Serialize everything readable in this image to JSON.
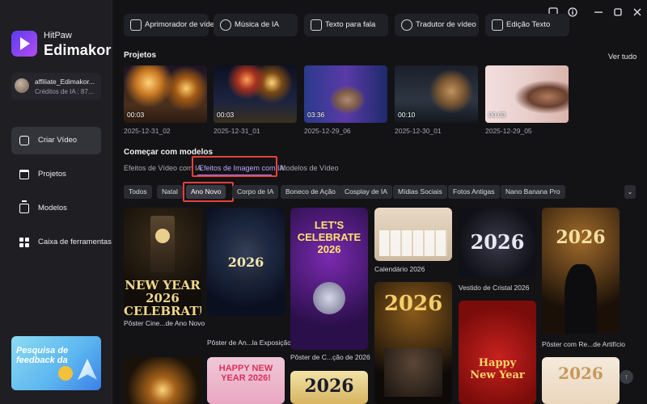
{
  "app": {
    "brand_top": "HitPaw",
    "brand_bottom": "Edimakor"
  },
  "account": {
    "name": "affiliate_Edimakor...",
    "credits": "Créditos de IA : 87..."
  },
  "nav": [
    {
      "label": "Criar Vídeo",
      "icon": "video-icon"
    },
    {
      "label": "Projetos",
      "icon": "folder-icon"
    },
    {
      "label": "Modelos",
      "icon": "templates-icon"
    },
    {
      "label": "Caixa de ferramentas",
      "icon": "toolbox-icon"
    }
  ],
  "promo": {
    "text": "Pesquisa de feedback da"
  },
  "tools": [
    {
      "label": "Aprimorador de vídeo",
      "icon": "video-enhance-icon"
    },
    {
      "label": "Música de IA",
      "icon": "music-note-icon"
    },
    {
      "label": "Texto para fala",
      "icon": "text-speech-icon"
    },
    {
      "label": "Tradutor de vídeo",
      "icon": "translate-icon"
    },
    {
      "label": "Edição Texto",
      "icon": "text-edit-icon"
    }
  ],
  "projects": {
    "title": "Projetos",
    "see_all": "Ver tudo",
    "items": [
      {
        "duration": "00:03",
        "name": "2025-12-31_02"
      },
      {
        "duration": "00:03",
        "name": "2025-12-31_01"
      },
      {
        "duration": "03:36",
        "name": "2025-12-29_06"
      },
      {
        "duration": "00:10",
        "name": "2025-12-30_01"
      },
      {
        "duration": "00:03",
        "name": "2025-12-29_05"
      }
    ]
  },
  "templates": {
    "title": "Começar com modelos",
    "tabs": [
      "Efeitos de Vídeo com IA",
      "Efeitos de Imagem com IA",
      "Modelos de Vídeo"
    ],
    "chips": [
      "Todos",
      "Natal",
      "Ano Novo",
      "Corpo de IA",
      "Boneco de Ação",
      "Cosplay de IA",
      "Mídias Sociais",
      "Fotos Antigas",
      "Nano Banana Pro"
    ],
    "cards": [
      {
        "caption": "Pôster Cine...de Ano Novo",
        "art": "NEW YEAR 2026 CELEBRATION"
      },
      {
        "caption": "Pôster de An...la Exposição",
        "art": "2026"
      },
      {
        "caption": "Pôster de C...ção de 2026",
        "art": "LET'S CELEBRATE 2026"
      },
      {
        "caption": "Calendário 2026",
        "art": ""
      },
      {
        "caption": "Vestido de Cristal 2026",
        "art": "2026"
      },
      {
        "caption": "Pôster com Re...de Artifício",
        "art": "2026"
      },
      {
        "caption": "",
        "art": "2026"
      },
      {
        "caption": "",
        "art": "Happy New Year"
      },
      {
        "caption": "",
        "art": "2026"
      },
      {
        "caption": "",
        "art": "HAPPY NEW YEAR 2026!"
      },
      {
        "caption": "",
        "art": "2026"
      },
      {
        "caption": "",
        "art": "2026"
      }
    ]
  },
  "colors": {
    "accent": "#9d84ff",
    "highlight": "#e8403a",
    "bg": "#131316",
    "sidebar": "#1e1e23"
  }
}
